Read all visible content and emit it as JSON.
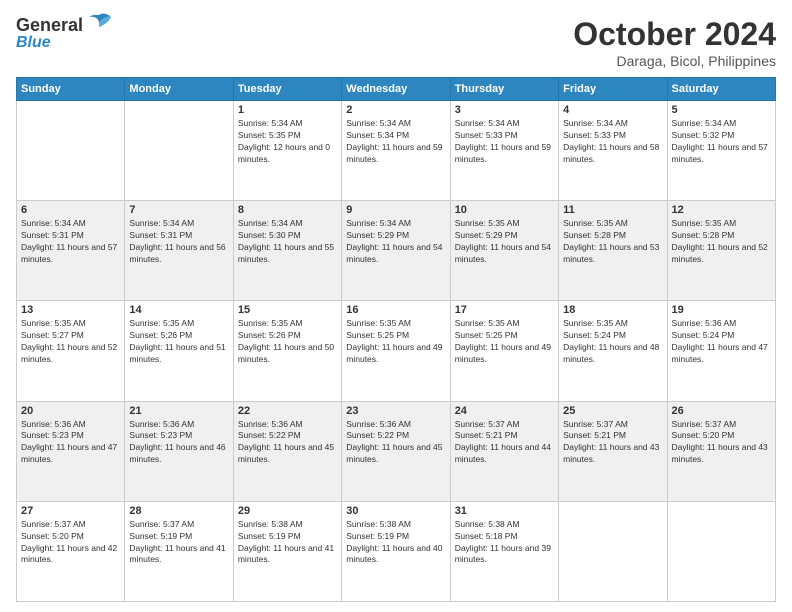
{
  "logo": {
    "line1": "General",
    "line2": "Blue"
  },
  "title": "October 2024",
  "subtitle": "Daraga, Bicol, Philippines",
  "days_of_week": [
    "Sunday",
    "Monday",
    "Tuesday",
    "Wednesday",
    "Thursday",
    "Friday",
    "Saturday"
  ],
  "weeks": [
    [
      {
        "day": "",
        "sunrise": "",
        "sunset": "",
        "daylight": ""
      },
      {
        "day": "",
        "sunrise": "",
        "sunset": "",
        "daylight": ""
      },
      {
        "day": "1",
        "sunrise": "Sunrise: 5:34 AM",
        "sunset": "Sunset: 5:35 PM",
        "daylight": "Daylight: 12 hours and 0 minutes."
      },
      {
        "day": "2",
        "sunrise": "Sunrise: 5:34 AM",
        "sunset": "Sunset: 5:34 PM",
        "daylight": "Daylight: 11 hours and 59 minutes."
      },
      {
        "day": "3",
        "sunrise": "Sunrise: 5:34 AM",
        "sunset": "Sunset: 5:33 PM",
        "daylight": "Daylight: 11 hours and 59 minutes."
      },
      {
        "day": "4",
        "sunrise": "Sunrise: 5:34 AM",
        "sunset": "Sunset: 5:33 PM",
        "daylight": "Daylight: 11 hours and 58 minutes."
      },
      {
        "day": "5",
        "sunrise": "Sunrise: 5:34 AM",
        "sunset": "Sunset: 5:32 PM",
        "daylight": "Daylight: 11 hours and 57 minutes."
      }
    ],
    [
      {
        "day": "6",
        "sunrise": "Sunrise: 5:34 AM",
        "sunset": "Sunset: 5:31 PM",
        "daylight": "Daylight: 11 hours and 57 minutes."
      },
      {
        "day": "7",
        "sunrise": "Sunrise: 5:34 AM",
        "sunset": "Sunset: 5:31 PM",
        "daylight": "Daylight: 11 hours and 56 minutes."
      },
      {
        "day": "8",
        "sunrise": "Sunrise: 5:34 AM",
        "sunset": "Sunset: 5:30 PM",
        "daylight": "Daylight: 11 hours and 55 minutes."
      },
      {
        "day": "9",
        "sunrise": "Sunrise: 5:34 AM",
        "sunset": "Sunset: 5:29 PM",
        "daylight": "Daylight: 11 hours and 54 minutes."
      },
      {
        "day": "10",
        "sunrise": "Sunrise: 5:35 AM",
        "sunset": "Sunset: 5:29 PM",
        "daylight": "Daylight: 11 hours and 54 minutes."
      },
      {
        "day": "11",
        "sunrise": "Sunrise: 5:35 AM",
        "sunset": "Sunset: 5:28 PM",
        "daylight": "Daylight: 11 hours and 53 minutes."
      },
      {
        "day": "12",
        "sunrise": "Sunrise: 5:35 AM",
        "sunset": "Sunset: 5:28 PM",
        "daylight": "Daylight: 11 hours and 52 minutes."
      }
    ],
    [
      {
        "day": "13",
        "sunrise": "Sunrise: 5:35 AM",
        "sunset": "Sunset: 5:27 PM",
        "daylight": "Daylight: 11 hours and 52 minutes."
      },
      {
        "day": "14",
        "sunrise": "Sunrise: 5:35 AM",
        "sunset": "Sunset: 5:26 PM",
        "daylight": "Daylight: 11 hours and 51 minutes."
      },
      {
        "day": "15",
        "sunrise": "Sunrise: 5:35 AM",
        "sunset": "Sunset: 5:26 PM",
        "daylight": "Daylight: 11 hours and 50 minutes."
      },
      {
        "day": "16",
        "sunrise": "Sunrise: 5:35 AM",
        "sunset": "Sunset: 5:25 PM",
        "daylight": "Daylight: 11 hours and 49 minutes."
      },
      {
        "day": "17",
        "sunrise": "Sunrise: 5:35 AM",
        "sunset": "Sunset: 5:25 PM",
        "daylight": "Daylight: 11 hours and 49 minutes."
      },
      {
        "day": "18",
        "sunrise": "Sunrise: 5:35 AM",
        "sunset": "Sunset: 5:24 PM",
        "daylight": "Daylight: 11 hours and 48 minutes."
      },
      {
        "day": "19",
        "sunrise": "Sunrise: 5:36 AM",
        "sunset": "Sunset: 5:24 PM",
        "daylight": "Daylight: 11 hours and 47 minutes."
      }
    ],
    [
      {
        "day": "20",
        "sunrise": "Sunrise: 5:36 AM",
        "sunset": "Sunset: 5:23 PM",
        "daylight": "Daylight: 11 hours and 47 minutes."
      },
      {
        "day": "21",
        "sunrise": "Sunrise: 5:36 AM",
        "sunset": "Sunset: 5:23 PM",
        "daylight": "Daylight: 11 hours and 46 minutes."
      },
      {
        "day": "22",
        "sunrise": "Sunrise: 5:36 AM",
        "sunset": "Sunset: 5:22 PM",
        "daylight": "Daylight: 11 hours and 45 minutes."
      },
      {
        "day": "23",
        "sunrise": "Sunrise: 5:36 AM",
        "sunset": "Sunset: 5:22 PM",
        "daylight": "Daylight: 11 hours and 45 minutes."
      },
      {
        "day": "24",
        "sunrise": "Sunrise: 5:37 AM",
        "sunset": "Sunset: 5:21 PM",
        "daylight": "Daylight: 11 hours and 44 minutes."
      },
      {
        "day": "25",
        "sunrise": "Sunrise: 5:37 AM",
        "sunset": "Sunset: 5:21 PM",
        "daylight": "Daylight: 11 hours and 43 minutes."
      },
      {
        "day": "26",
        "sunrise": "Sunrise: 5:37 AM",
        "sunset": "Sunset: 5:20 PM",
        "daylight": "Daylight: 11 hours and 43 minutes."
      }
    ],
    [
      {
        "day": "27",
        "sunrise": "Sunrise: 5:37 AM",
        "sunset": "Sunset: 5:20 PM",
        "daylight": "Daylight: 11 hours and 42 minutes."
      },
      {
        "day": "28",
        "sunrise": "Sunrise: 5:37 AM",
        "sunset": "Sunset: 5:19 PM",
        "daylight": "Daylight: 11 hours and 41 minutes."
      },
      {
        "day": "29",
        "sunrise": "Sunrise: 5:38 AM",
        "sunset": "Sunset: 5:19 PM",
        "daylight": "Daylight: 11 hours and 41 minutes."
      },
      {
        "day": "30",
        "sunrise": "Sunrise: 5:38 AM",
        "sunset": "Sunset: 5:19 PM",
        "daylight": "Daylight: 11 hours and 40 minutes."
      },
      {
        "day": "31",
        "sunrise": "Sunrise: 5:38 AM",
        "sunset": "Sunset: 5:18 PM",
        "daylight": "Daylight: 11 hours and 39 minutes."
      },
      {
        "day": "",
        "sunrise": "",
        "sunset": "",
        "daylight": ""
      },
      {
        "day": "",
        "sunrise": "",
        "sunset": "",
        "daylight": ""
      }
    ]
  ]
}
